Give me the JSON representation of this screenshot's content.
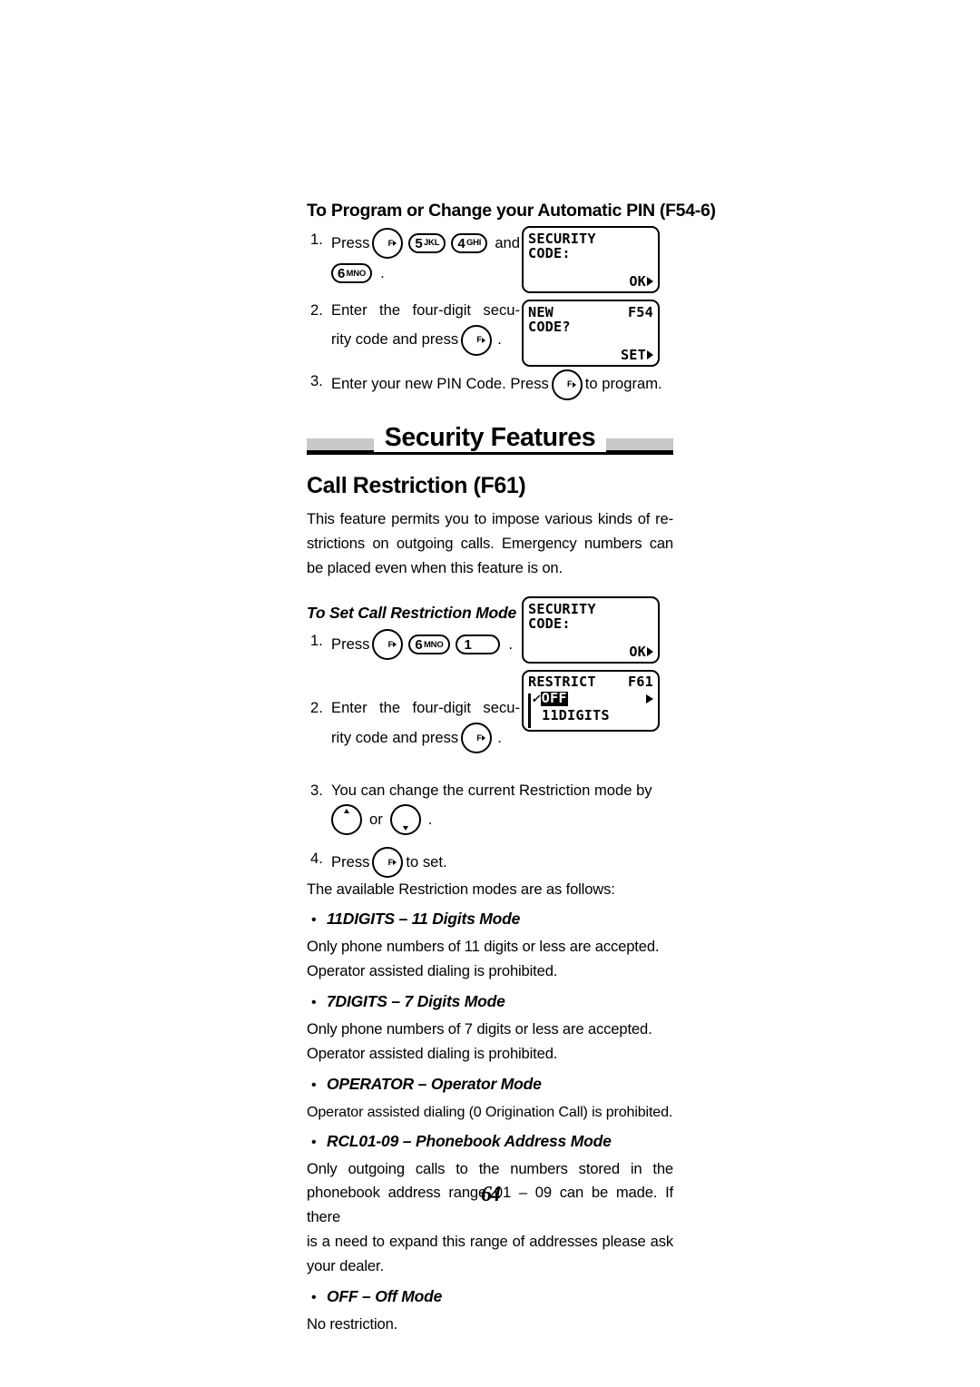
{
  "page": {
    "number": "64"
  },
  "top_section": {
    "heading": "To Program or Change your Automatic PIN (F54-6)",
    "steps": [
      {
        "num": "1.",
        "press_label": "Press",
        "and_label": "and",
        "period": ".",
        "keys": [
          "F",
          "5 JKL",
          "4 GHI",
          "6 MNO"
        ]
      },
      {
        "num": "2.",
        "text_line1": "Enter the four-digit secu-",
        "text_line2a": "rity code and press",
        "period": ".",
        "keys": [
          "F"
        ]
      },
      {
        "num": "3.",
        "text_a": "Enter your new PIN Code. Press",
        "text_b": "to program.",
        "keys": [
          "F"
        ]
      }
    ],
    "lcd1": {
      "line1": "SECURITY",
      "line2": "CODE:",
      "softkey": "OK"
    },
    "lcd2": {
      "line1_left": "NEW",
      "line1_right": "F54",
      "line2": "CODE?",
      "softkey": "SET"
    }
  },
  "banner": {
    "title": "Security Features"
  },
  "feature": {
    "heading": "Call Restriction (F61)",
    "intro_lines": [
      "This feature permits you to impose various kinds of re-",
      "strictions on outgoing calls. Emergency numbers can",
      "be placed even when this feature is on."
    ],
    "sub_heading": "To Set Call Restriction Mode",
    "steps": [
      {
        "num": "1.",
        "press_label": "Press",
        "period": ".",
        "keys": [
          "F",
          "6 MNO",
          "1"
        ]
      },
      {
        "num": "2.",
        "text_line1": "Enter the four-digit secu-",
        "text_line2a": "rity code and press",
        "period": ".",
        "keys": [
          "F"
        ]
      },
      {
        "num": "3.",
        "text_a": "You can change the current Restriction mode by",
        "or_label": "or",
        "period": "."
      },
      {
        "num": "4.",
        "press_label": "Press",
        "text_b": "to set."
      }
    ],
    "lcd3": {
      "line1": "SECURITY",
      "line2": "CODE:",
      "softkey": "OK"
    },
    "lcd4": {
      "title_left": "RESTRICT",
      "title_right": "F61",
      "check": "✓",
      "selected_item": "OFF",
      "next_item": "11DIGITS"
    },
    "modes_intro": "The available Restriction modes are as follows:",
    "modes": [
      {
        "bullet": "•",
        "title": "11DIGITS – 11 Digits Mode",
        "lines": [
          "Only phone numbers of 11 digits or less are accepted.",
          "Operator assisted dialing is prohibited."
        ],
        "justify": false
      },
      {
        "bullet": "•",
        "title": "7DIGITS – 7 Digits Mode",
        "lines": [
          "Only phone numbers of 7 digits or less are accepted.",
          "Operator assisted dialing is prohibited."
        ],
        "justify": false
      },
      {
        "bullet": "•",
        "title": "OPERATOR – Operator Mode",
        "lines": [
          "Operator assisted dialing (0 Origination Call) is prohibited."
        ],
        "justify": false
      },
      {
        "bullet": "•",
        "title": "RCL01-09 – Phonebook Address Mode",
        "lines": [
          "Only outgoing calls to the numbers stored in the",
          "phonebook address range 01 – 09 can be made. If there",
          "is a need to expand this range of addresses please ask",
          "your dealer."
        ],
        "justify": true
      },
      {
        "bullet": "•",
        "title": "OFF – Off Mode",
        "lines": [
          "No restriction."
        ],
        "justify": false
      }
    ]
  },
  "keys": {
    "f": {
      "letter": "F"
    },
    "k5": {
      "digit": "5",
      "letters": "JKL"
    },
    "k4": {
      "digit": "4",
      "letters": "GHI"
    },
    "k6": {
      "digit": "6",
      "letters": "MNO"
    },
    "k1": {
      "digit": "1",
      "letters": ""
    }
  }
}
